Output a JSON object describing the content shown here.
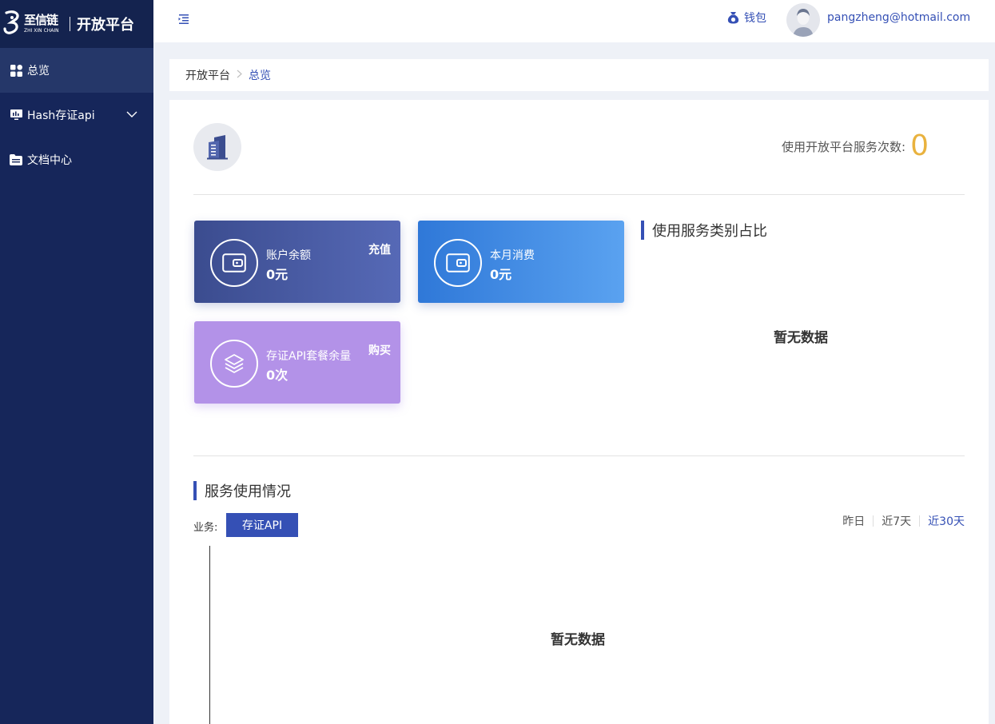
{
  "brand": {
    "logo_cn": "至信链",
    "logo_en": "ZHI XIN CHAIN",
    "title": "开放平台"
  },
  "sidebar": {
    "items": [
      {
        "label": "总览",
        "icon": "grid-icon",
        "active": true
      },
      {
        "label": "Hash存证api",
        "icon": "monitor-icon",
        "expandable": true
      },
      {
        "label": "文档中心",
        "icon": "folder-icon"
      }
    ]
  },
  "header": {
    "wallet_label": "钱包",
    "user_email": "pangzheng@hotmail.com"
  },
  "breadcrumb": {
    "root": "开放平台",
    "current": "总览"
  },
  "overview": {
    "usage_label": "使用开放平台服务次数:",
    "usage_value": "0"
  },
  "cards": [
    {
      "label": "账户余额",
      "value": "0元",
      "action": "充值",
      "icon": "wallet-icon"
    },
    {
      "label": "本月消费",
      "value": "0元",
      "icon": "wallet-icon"
    },
    {
      "label": "存证API套餐余量",
      "value": "0次",
      "action": "购买",
      "icon": "layers-icon"
    }
  ],
  "service_ratio": {
    "title": "使用服务类别占比",
    "empty_text": "暂无数据"
  },
  "service_usage": {
    "title": "服务使用情况",
    "business_label": "业务:",
    "business_button": "存证API",
    "range_options": [
      "昨日",
      "近7天",
      "近30天"
    ],
    "active_range": "近30天",
    "empty_text": "暂无数据"
  },
  "colors": {
    "sidebar_bg": "#16265a",
    "accent": "#3550b5",
    "usage_value": "#e9b23e",
    "card_purple": "#b392e8"
  }
}
